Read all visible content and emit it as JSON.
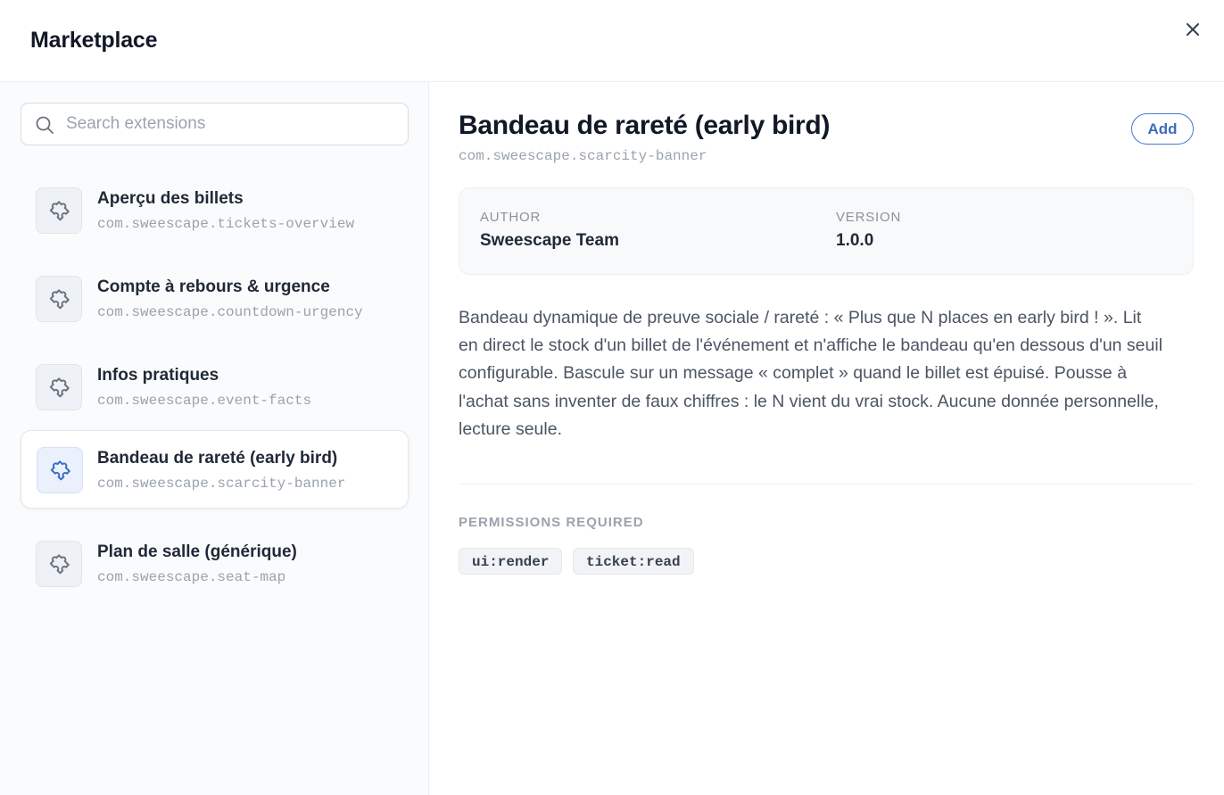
{
  "header": {
    "title": "Marketplace"
  },
  "colors": {
    "accent": "#3d6cc2",
    "icon_muted": "#6b7280"
  },
  "search": {
    "placeholder": "Search extensions",
    "value": ""
  },
  "extensions": [
    {
      "name": "Aperçu des billets",
      "id": "com.sweescape.tickets-overview",
      "icon": "puzzle-icon"
    },
    {
      "name": "Compte à rebours & urgence",
      "id": "com.sweescape.countdown-urgency",
      "icon": "puzzle-icon"
    },
    {
      "name": "Infos pratiques",
      "id": "com.sweescape.event-facts",
      "icon": "puzzle-icon"
    },
    {
      "name": "Bandeau de rareté (early bird)",
      "id": "com.sweescape.scarcity-banner",
      "icon": "puzzle-icon",
      "selected": true
    },
    {
      "name": "Plan de salle (générique)",
      "id": "com.sweescape.seat-map",
      "icon": "puzzle-icon"
    }
  ],
  "detail": {
    "title": "Bandeau de rareté (early bird)",
    "id": "com.sweescape.scarcity-banner",
    "add_label": "Add",
    "author_label": "AUTHOR",
    "author": "Sweescape Team",
    "version_label": "VERSION",
    "version": "1.0.0",
    "description": "Bandeau dynamique de preuve sociale / rareté : « Plus que N places en early bird ! ». Lit en direct le stock d'un billet de l'événement et n'affiche le bandeau qu'en dessous d'un seuil configurable. Bascule sur un message « complet » quand le billet est épuisé. Pousse à l'achat sans inventer de faux chiffres : le N vient du vrai stock. Aucune donnée personnelle, lecture seule.",
    "permissions_heading": "PERMISSIONS REQUIRED",
    "permissions": [
      "ui:render",
      "ticket:read"
    ]
  }
}
